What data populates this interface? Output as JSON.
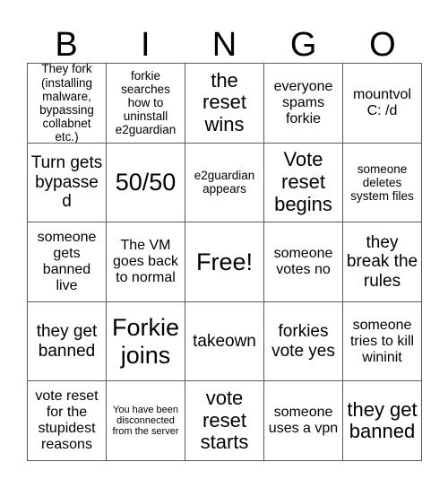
{
  "header": {
    "letters": [
      "B",
      "I",
      "N",
      "G",
      "O"
    ]
  },
  "grid": {
    "rows": 5,
    "columns": 5,
    "border_color": "#5a5a5a",
    "background_color": "#ffffff",
    "text_color": "#000000",
    "cells": [
      {
        "text": "They fork (installing malware, bypassing collabnet etc.)",
        "size": "fs-sm"
      },
      {
        "text": "forkie searches how to uninstall e2guardian",
        "size": "fs-sm"
      },
      {
        "text": "the reset wins",
        "size": "fs-xl"
      },
      {
        "text": "everyone spams forkie",
        "size": "fs-md"
      },
      {
        "text": "mountvol C: /d",
        "size": "fs-md"
      },
      {
        "text": "Turn gets bypassed",
        "size": "fs-lg"
      },
      {
        "text": "50/50",
        "size": "fs-xxl"
      },
      {
        "text": "e2guardian appears",
        "size": "fs-sm"
      },
      {
        "text": "Vote reset begins",
        "size": "fs-xl"
      },
      {
        "text": "someone deletes system files",
        "size": "fs-sm"
      },
      {
        "text": "someone gets banned live",
        "size": "fs-md"
      },
      {
        "text": "The VM goes back to normal",
        "size": "fs-md"
      },
      {
        "text": "Free!",
        "size": "fs-xxl"
      },
      {
        "text": "someone votes no",
        "size": "fs-md"
      },
      {
        "text": "they break the rules",
        "size": "fs-lg"
      },
      {
        "text": "they get banned",
        "size": "fs-lg"
      },
      {
        "text": "Forkie joins",
        "size": "fs-xxl"
      },
      {
        "text": "takeown",
        "size": "fs-lg"
      },
      {
        "text": "forkies vote yes",
        "size": "fs-lg"
      },
      {
        "text": "someone tries to kill wininit",
        "size": "fs-md"
      },
      {
        "text": "vote reset for the stupidest reasons",
        "size": "fs-md"
      },
      {
        "text": "You have been disconnected from the server",
        "size": "fs-xs"
      },
      {
        "text": "vote reset starts",
        "size": "fs-xl"
      },
      {
        "text": "someone uses a vpn",
        "size": "fs-md"
      },
      {
        "text": "they get banned",
        "size": "fs-xl"
      }
    ]
  }
}
